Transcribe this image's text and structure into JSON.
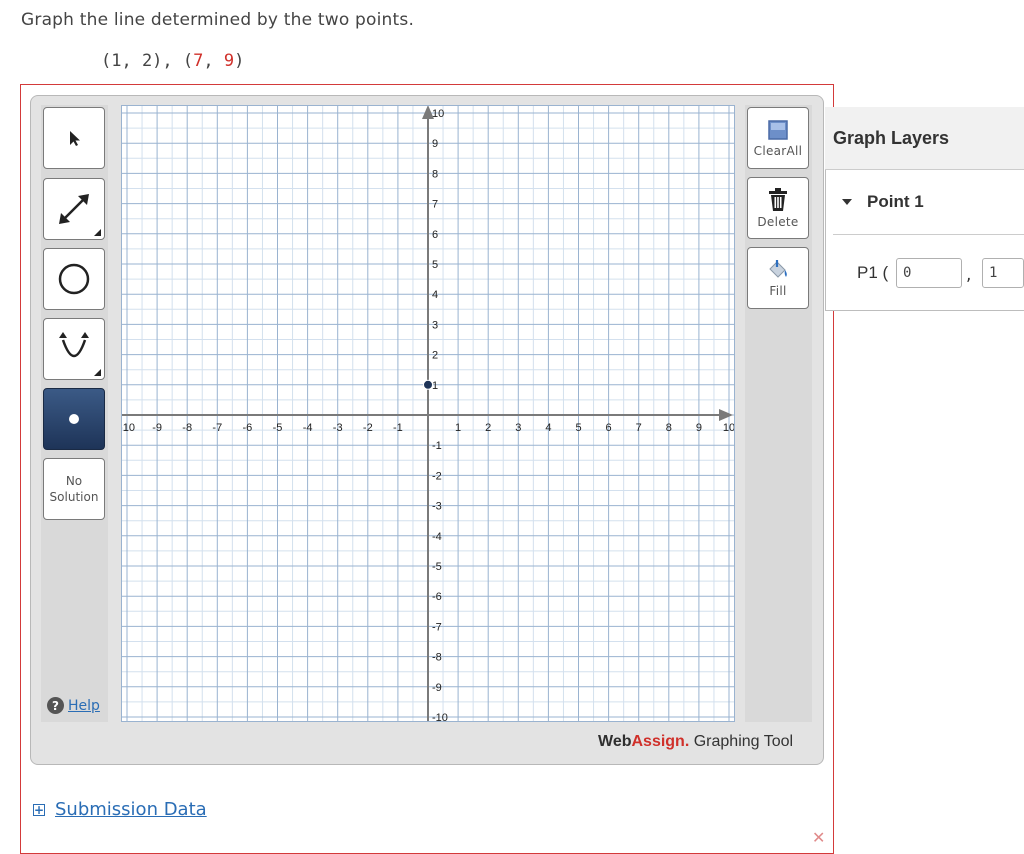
{
  "question": {
    "prompt": "Graph the line determined by the two points.",
    "points_open": "(1, 2), (",
    "p2_x": "7",
    "comma": ", ",
    "p2_y": "9",
    "close": ")"
  },
  "toolbar_left": {
    "pointer_icon": "arrow-cursor-icon",
    "line_icon": "double-arrow-line-icon",
    "circle_icon": "circle-icon",
    "parabola_icon": "parabola-icon",
    "point_icon": "point-icon",
    "no_solution_line1": "No",
    "no_solution_line2": "Solution",
    "help_label": "Help"
  },
  "toolbar_right": {
    "clear_all_label": "ClearAll",
    "delete_label": "Delete",
    "fill_label": "Fill"
  },
  "chart_data": {
    "type": "scatter",
    "xlim": [
      -10,
      10
    ],
    "ylim": [
      -10,
      10
    ],
    "x_ticks": [
      -10,
      -9,
      -8,
      -7,
      -6,
      -5,
      -4,
      -3,
      -2,
      -1,
      1,
      2,
      3,
      4,
      5,
      6,
      7,
      8,
      9,
      10
    ],
    "y_ticks": [
      -10,
      -9,
      -8,
      -7,
      -6,
      -5,
      -4,
      -3,
      -2,
      -1,
      1,
      2,
      3,
      4,
      5,
      6,
      7,
      8,
      9,
      10
    ],
    "grid": true,
    "minor_per_unit": 2,
    "points": [
      {
        "x": 0,
        "y": 1
      }
    ],
    "colors": {
      "major": "#9ab3d0",
      "minor": "#d3e0ee",
      "axis": "#7a7a7a",
      "point": "#1e3458"
    }
  },
  "brand": {
    "web": "Web",
    "assign": "Assign.",
    "tool": " Graphing Tool"
  },
  "layers_panel": {
    "title": "Graph Layers",
    "item_label": "Point 1",
    "p1_label": "P1 (",
    "p1_x": "0",
    "comma": ",",
    "p1_y": "1"
  },
  "submission": {
    "label": "Submission Data"
  }
}
